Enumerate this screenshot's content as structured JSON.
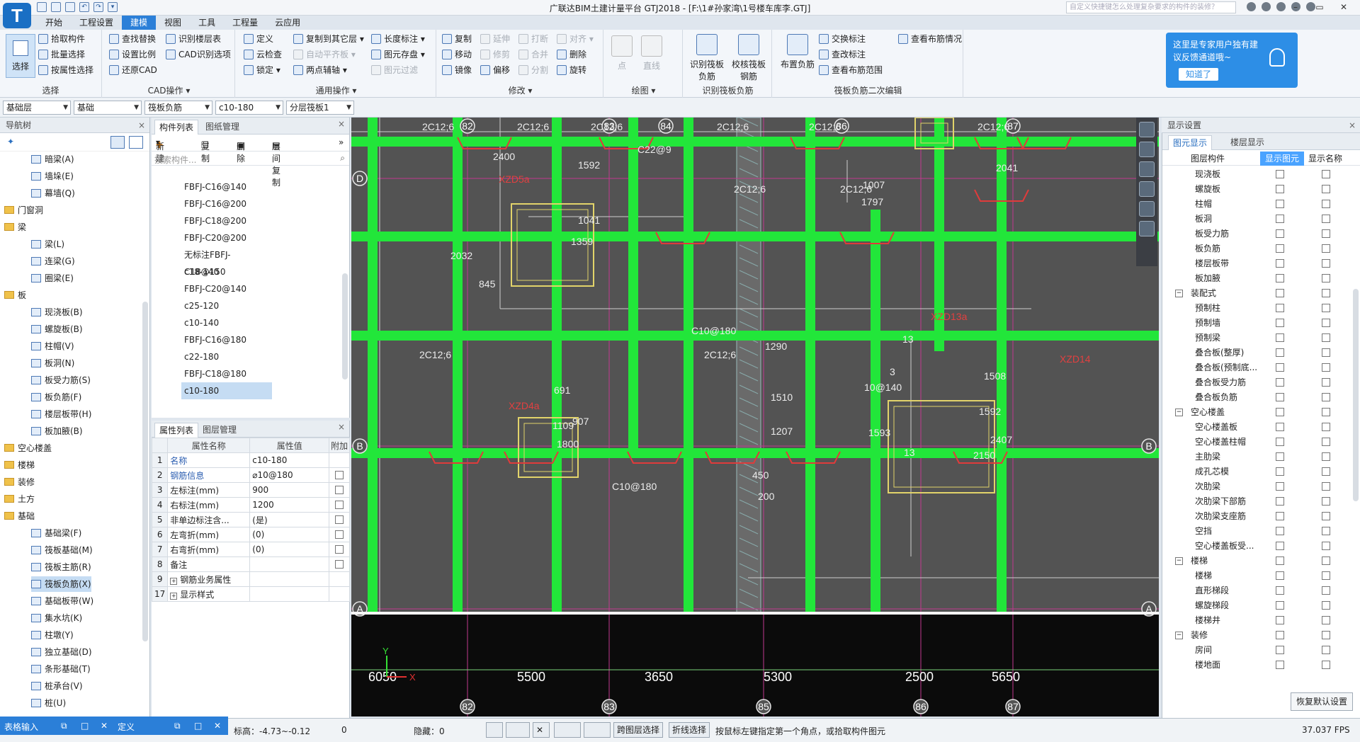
{
  "window": {
    "title": "广联达BIM土建计量平台 GTJ2018 - [F:\\1#孙家湾\\1号楼车库李.GTJ]",
    "search_placeholder": "自定义快捷键怎么处理复杂要求的构件的装修？",
    "logo": "T",
    "min": "–",
    "restore": "▭",
    "close": "✕"
  },
  "menu": [
    "开始",
    "工程设置",
    "建模",
    "视图",
    "工具",
    "工程量",
    "云应用"
  ],
  "ribbon": {
    "select": {
      "big": "选择",
      "items": [
        "拾取构件",
        "批量选择",
        "按属性选择"
      ],
      "label": "选择"
    },
    "cad": {
      "items": [
        "查找替换",
        "识别楼层表",
        "设置比例",
        "CAD识别选项",
        "还原CAD"
      ],
      "label": "CAD操作"
    },
    "common": {
      "items": [
        "定义",
        "复制到其它层",
        "长度标注",
        "云检查",
        "自动平齐板",
        "图元存盘",
        "锁定",
        "两点辅轴",
        "图元过滤"
      ],
      "label": "通用操作"
    },
    "modify": {
      "items": [
        "复制",
        "延伸",
        "打断",
        "对齐",
        "移动",
        "修剪",
        "合并",
        "删除",
        "镜像",
        "偏移",
        "分割",
        "旋转"
      ],
      "label": "修改"
    },
    "draw": {
      "items": [
        "点",
        "直线"
      ],
      "label": "绘图"
    },
    "identify": {
      "items": [
        "识别筏板负筋",
        "校核筏板钢筋"
      ],
      "label": "识别筏板负筋"
    },
    "edit2": {
      "big": "布置负筋",
      "items": [
        "交换标注",
        "查看布筋情况",
        "查改标注",
        "查看布筋范围"
      ],
      "label": "筏板负筋二次编辑"
    }
  },
  "tip": {
    "text": "这里是专家用户独有建议反馈通道哦~",
    "ok": "知道了"
  },
  "combos": [
    "基础层",
    "基础",
    "筏板负筋",
    "c10-180",
    "分层筏板1"
  ],
  "nav": {
    "title": "导航树",
    "rows": [
      {
        "t": "暗梁(A)",
        "k": "i"
      },
      {
        "t": "墙垛(E)",
        "k": "i"
      },
      {
        "t": "幕墙(Q)",
        "k": "i"
      },
      {
        "t": "门窗洞",
        "k": "f"
      },
      {
        "t": "梁",
        "k": "f"
      },
      {
        "t": "梁(L)",
        "k": "i"
      },
      {
        "t": "连梁(G)",
        "k": "i"
      },
      {
        "t": "圈梁(E)",
        "k": "i"
      },
      {
        "t": "板",
        "k": "f"
      },
      {
        "t": "现浇板(B)",
        "k": "i"
      },
      {
        "t": "螺旋板(B)",
        "k": "i"
      },
      {
        "t": "柱帽(V)",
        "k": "i"
      },
      {
        "t": "板洞(N)",
        "k": "i"
      },
      {
        "t": "板受力筋(S)",
        "k": "i"
      },
      {
        "t": "板负筋(F)",
        "k": "i"
      },
      {
        "t": "楼层板带(H)",
        "k": "i"
      },
      {
        "t": "板加腋(B)",
        "k": "i"
      },
      {
        "t": "空心楼盖",
        "k": "f"
      },
      {
        "t": "楼梯",
        "k": "f"
      },
      {
        "t": "装修",
        "k": "f"
      },
      {
        "t": "土方",
        "k": "f"
      },
      {
        "t": "基础",
        "k": "f"
      },
      {
        "t": "基础梁(F)",
        "k": "i"
      },
      {
        "t": "筏板基础(M)",
        "k": "i"
      },
      {
        "t": "筏板主筋(R)",
        "k": "i"
      },
      {
        "t": "筏板负筋(X)",
        "k": "i",
        "sel": true
      },
      {
        "t": "基础板带(W)",
        "k": "i"
      },
      {
        "t": "集水坑(K)",
        "k": "i"
      },
      {
        "t": "柱墩(Y)",
        "k": "i"
      },
      {
        "t": "独立基础(D)",
        "k": "i"
      },
      {
        "t": "条形基础(T)",
        "k": "i"
      },
      {
        "t": "桩承台(V)",
        "k": "i"
      },
      {
        "t": "桩(U)",
        "k": "i"
      }
    ]
  },
  "comp": {
    "tab1": "构件列表",
    "tab2": "图纸管理",
    "new": "新建",
    "copy": "复制",
    "del": "删除",
    "layer_copy": "层间复制",
    "search": "搜索构件...",
    "items": [
      "FBFJ-C16@140",
      "FBFJ-C16@200",
      "FBFJ-C18@200",
      "FBFJ-C20@200",
      "无标注FBFJ-C18@150",
      "c18-140",
      "FBFJ-C20@140",
      "c25-120",
      "c10-140",
      "FBFJ-C16@180",
      "c22-180",
      "FBFJ-C18@180",
      "c10-180"
    ]
  },
  "attr": {
    "tab1": "属性列表",
    "tab2": "图层管理",
    "headers": [
      "属性名称",
      "属性值",
      "附加"
    ],
    "rows": [
      [
        "1",
        "名称",
        "c10-180"
      ],
      [
        "2",
        "钢筋信息",
        "⌀10@180"
      ],
      [
        "3",
        "左标注(mm)",
        "900"
      ],
      [
        "4",
        "右标注(mm)",
        "1200"
      ],
      [
        "5",
        "非单边标注含...",
        "(是)"
      ],
      [
        "6",
        "左弯折(mm)",
        "(0)"
      ],
      [
        "7",
        "右弯折(mm)",
        "(0)"
      ],
      [
        "8",
        "备注",
        ""
      ],
      [
        "9",
        "钢筋业务属性",
        ""
      ],
      [
        "17",
        "显示样式",
        ""
      ]
    ]
  },
  "canvas": {
    "axes_top": [
      "82",
      "83",
      "84",
      "86",
      "87"
    ],
    "axes_bottom": [
      "82",
      "83",
      "85",
      "86",
      "87"
    ],
    "row_labels": [
      "D",
      "B",
      "A"
    ],
    "dims_bottom": [
      "6050",
      "5500",
      "3650",
      "5300",
      "2500",
      "5650"
    ],
    "texts": [
      "2C12;6",
      "2C12;6",
      "2C12;6",
      "2C12;6",
      "2C12;6",
      "2C12;6",
      "2C12;6",
      "2C12;6",
      "2C12;6",
      "2C12;6",
      "2400",
      "1592",
      "1041",
      "1359",
      "2032",
      "845",
      "C10@180",
      "XZD5a",
      "XZD4a",
      "XZD13a",
      "691",
      "1109",
      "907",
      "1800",
      "C10@180",
      "1290",
      "1510",
      "1207",
      "450",
      "200",
      "1593",
      "1508",
      "2150",
      "1592",
      "2407",
      "1797",
      "1007",
      "2041",
      "C22@9",
      "XZD14",
      "13",
      "13",
      "10@140",
      "3"
    ]
  },
  "display": {
    "title": "显示设置",
    "tab1": "图元显示",
    "tab2": "楼层显示",
    "headers": [
      "图层构件",
      "显示图元",
      "显示名称"
    ],
    "rows": [
      {
        "n": "现浇板"
      },
      {
        "n": "螺旋板"
      },
      {
        "n": "柱帽"
      },
      {
        "n": "板洞"
      },
      {
        "n": "板受力筋"
      },
      {
        "n": "板负筋"
      },
      {
        "n": "楼层板带"
      },
      {
        "n": "板加腋"
      },
      {
        "n": "装配式",
        "g": true
      },
      {
        "n": "预制柱"
      },
      {
        "n": "预制墙"
      },
      {
        "n": "预制梁"
      },
      {
        "n": "叠合板(整厚)"
      },
      {
        "n": "叠合板(预制底..."
      },
      {
        "n": "叠合板受力筋"
      },
      {
        "n": "叠合板负筋"
      },
      {
        "n": "空心楼盖",
        "g": true
      },
      {
        "n": "空心楼盖板"
      },
      {
        "n": "空心楼盖柱帽"
      },
      {
        "n": "主肋梁"
      },
      {
        "n": "成孔芯模"
      },
      {
        "n": "次肋梁"
      },
      {
        "n": "次肋梁下部筋"
      },
      {
        "n": "次肋梁支座筋"
      },
      {
        "n": "空挡"
      },
      {
        "n": "空心楼盖板受..."
      },
      {
        "n": "楼梯",
        "g": true
      },
      {
        "n": "楼梯"
      },
      {
        "n": "直形梯段"
      },
      {
        "n": "螺旋梯段"
      },
      {
        "n": "楼梯井"
      },
      {
        "n": "装修",
        "g": true
      },
      {
        "n": "房间"
      },
      {
        "n": "楼地面"
      }
    ],
    "restore": "恢复默认设置"
  },
  "bottom_panel": {
    "a": "表格输入",
    "b": "定义"
  },
  "status": {
    "elev": "标高：-4.73~-0.12",
    "zero": "0",
    "hidden": "隐藏：0",
    "cross_layer": "跨图层选择",
    "polyline": "折线选择",
    "hint": "按鼠标左键指定第一个角点，或拾取构件图元",
    "fps": "37.037 FPS"
  }
}
